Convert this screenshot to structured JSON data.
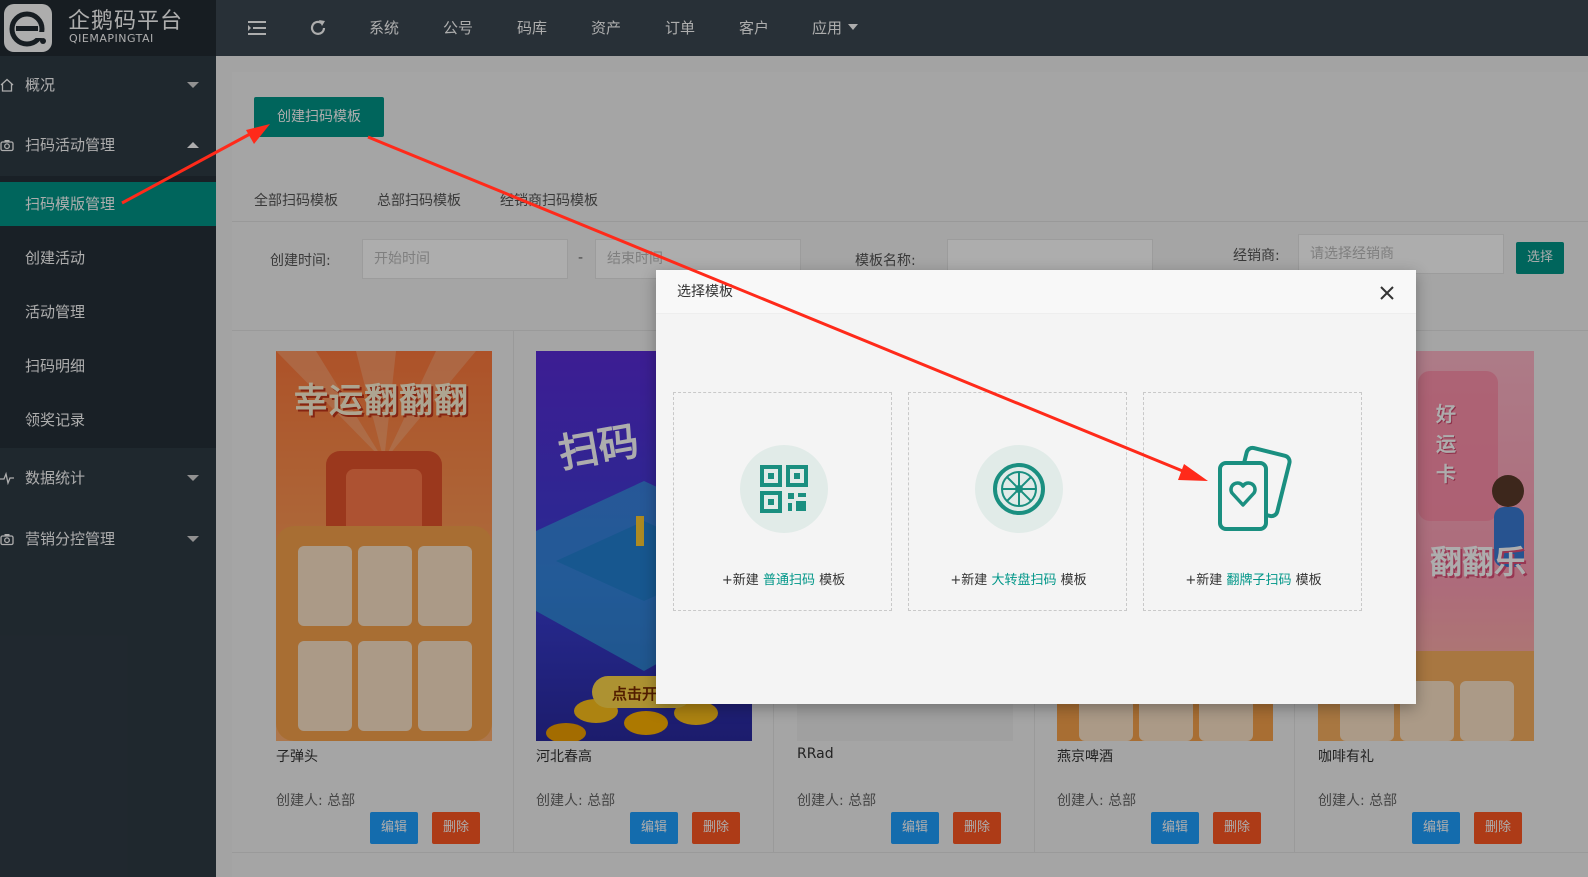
{
  "app": {
    "logo_title": "企鹅码平台",
    "logo_subtitle": "QIEMAPINGTAI"
  },
  "sidebar": {
    "items": [
      {
        "label": "概况",
        "icon": "home-icon"
      },
      {
        "label": "扫码活动管理",
        "icon": "camera-icon"
      },
      {
        "label": "数据统计",
        "icon": "pulse-icon"
      },
      {
        "label": "营销分控管理",
        "icon": "camera-icon"
      }
    ],
    "submenu": [
      "扫码模版管理",
      "创建活动",
      "活动管理",
      "扫码明细",
      "领奖记录"
    ],
    "active_sub": "扫码模版管理"
  },
  "topnav": {
    "items": [
      "系统",
      "公号",
      "码库",
      "资产",
      "订单",
      "客户",
      "应用"
    ]
  },
  "toolbar": {
    "create_label": "创建扫码模板"
  },
  "tabs": [
    "全部扫码模板",
    "总部扫码模板",
    "经销商扫码模板"
  ],
  "filters": {
    "created_label": "创建时间:",
    "start_placeholder": "开始时间",
    "dash": "-",
    "end_placeholder": "结束时间",
    "name_label": "模板名称:",
    "dealer_label": "经销商:",
    "dealer_placeholder": "请选择经销商",
    "choose_label": "选择"
  },
  "cards": [
    {
      "name": "子弹头",
      "creator": "创建人: 总部",
      "edit": "编辑",
      "delete": "删除"
    },
    {
      "name": "河北春高",
      "creator": "创建人: 总部",
      "edit": "编辑",
      "delete": "删除"
    },
    {
      "name": "RRad",
      "creator": "创建人: 总部",
      "edit": "编辑",
      "delete": "删除"
    },
    {
      "name": "燕京啤酒",
      "creator": "创建人: 总部",
      "edit": "编辑",
      "delete": "删除"
    },
    {
      "name": "咖啡有礼",
      "creator": "创建人: 总部",
      "edit": "编辑",
      "delete": "删除"
    }
  ],
  "poster_text": {
    "card1_banner": "幸运翻翻翻",
    "card2_banner": "扫码",
    "card2_button": "点击开",
    "card5_vertical": "好运卡",
    "card5_banner": "翻翻乐"
  },
  "modal": {
    "title": "选择模板",
    "options": [
      {
        "prefix": "+新建",
        "highlight": "普通扫码",
        "suffix": "模板",
        "icon": "qr-code-icon"
      },
      {
        "prefix": "+新建",
        "highlight": "大转盘扫码",
        "suffix": "模板",
        "icon": "wheel-icon"
      },
      {
        "prefix": "+新建",
        "highlight": "翻牌子扫码",
        "suffix": "模板",
        "icon": "cards-heart-icon"
      }
    ]
  },
  "colors": {
    "primary": "#009688",
    "sidebar": "#2f3b45",
    "topbar": "#3b4751",
    "edit": "#1e9fff",
    "delete": "#ff5722",
    "annotation": "#ff2a1a"
  }
}
